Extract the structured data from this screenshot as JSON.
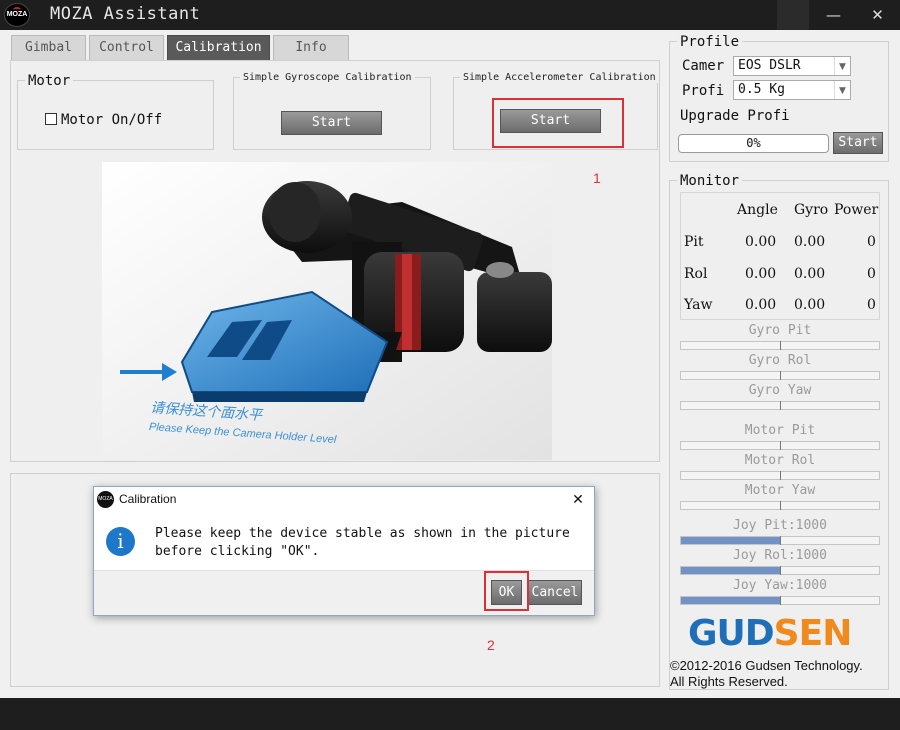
{
  "window": {
    "title": "MOZA Assistant",
    "logo_text": "MOZA",
    "close_glyph": "✕",
    "minimize_glyph": "—"
  },
  "tabs": [
    {
      "label": "Gimbal",
      "active": false
    },
    {
      "label": "Control",
      "active": false
    },
    {
      "label": "Calibration",
      "active": true
    },
    {
      "label": "Info",
      "active": false
    }
  ],
  "motor": {
    "group_title": "Motor",
    "checkbox_label": "Motor On/Off",
    "checked": false
  },
  "gyro_cal": {
    "title": "Simple Gyroscope Calibration",
    "button": "Start"
  },
  "accel_cal": {
    "title": "Simple Accelerometer Calibration",
    "button": "Start"
  },
  "annotations": {
    "step1": "1",
    "step2": "2"
  },
  "picture": {
    "caption_cn": "请保持这个面水平",
    "caption_en": "Please Keep the Camera Holder Level"
  },
  "profile": {
    "title": "Profile",
    "camera_label": "Camer",
    "camera_value": "EOS DSLR",
    "profile_label": "Profi",
    "profile_value": "0.5 Kg",
    "upgrade_label": "Upgrade Profi",
    "progress_text": "0%",
    "progress": 0,
    "start_button": "Start"
  },
  "monitor": {
    "title": "Monitor",
    "headers": [
      "Angle",
      "Gyro",
      "Power"
    ],
    "rows": [
      {
        "axis": "Pit",
        "angle": "0.00",
        "gyro": "0.00",
        "power": "0"
      },
      {
        "axis": "Rol",
        "angle": "0.00",
        "gyro": "0.00",
        "power": "0"
      },
      {
        "axis": "Yaw",
        "angle": "0.00",
        "gyro": "0.00",
        "power": "0"
      }
    ],
    "sliders": [
      {
        "label": "Gyro Pit",
        "fill": 0
      },
      {
        "label": "Gyro Rol",
        "fill": 0
      },
      {
        "label": "Gyro Yaw",
        "fill": 0
      },
      {
        "label": "Motor Pit",
        "fill": 0
      },
      {
        "label": "Motor Rol",
        "fill": 0
      },
      {
        "label": "Motor Yaw",
        "fill": 0
      },
      {
        "label": "Joy Pit:1000",
        "fill": 0.5
      },
      {
        "label": "Joy Rol:1000",
        "fill": 0.5
      },
      {
        "label": "Joy Yaw:1000",
        "fill": 0.5
      }
    ]
  },
  "brand": {
    "name_part1": "GUD",
    "name_part2": "SEN",
    "copyright": "©2012-2016 Gudsen Technology.",
    "rights": "All Rights Reserved."
  },
  "dialog": {
    "title": "Calibration",
    "message_line1": "Please keep the device stable as shown in the picture",
    "message_line2": "before clicking \"OK\".",
    "ok": "OK",
    "cancel": "Cancel",
    "close_glyph": "✕",
    "info_glyph": "i"
  },
  "colors": {
    "accent_red": "#d9303a",
    "slider_fill": "#7292c6",
    "brand_blue": "#1f6fb8",
    "brand_orange": "#f08a1c"
  }
}
